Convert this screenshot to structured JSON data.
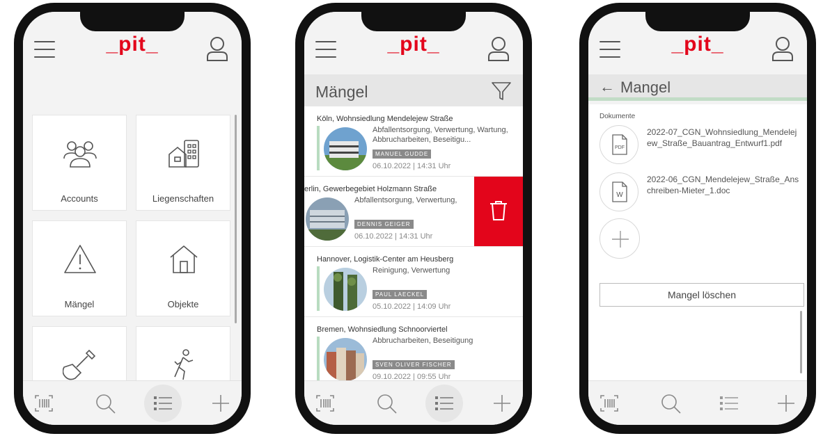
{
  "brand": {
    "logo": "_pit_",
    "accent_color": "#e3051b",
    "positive_color": "#b8dcc0"
  },
  "icons": {
    "menu": "hamburger-icon",
    "user": "user-icon",
    "barcode": "barcode-icon",
    "search": "search-icon",
    "list": "list-icon",
    "add": "plus-icon",
    "filter": "filter-icon",
    "delete": "trash-icon"
  },
  "phone1": {
    "tiles": [
      {
        "label": "Accounts",
        "icon": "users-icon"
      },
      {
        "label": "Liegenschaften",
        "icon": "buildings-icon"
      },
      {
        "label": "Mängel",
        "icon": "warning-icon"
      },
      {
        "label": "Objekte",
        "icon": "house-icon"
      },
      {
        "label": "",
        "icon": "shovel-icon"
      },
      {
        "label": "",
        "icon": "walking-person-icon"
      }
    ]
  },
  "phone2": {
    "title": "Mängel",
    "items": [
      {
        "address": "Köln, Wohnsiedlung Mendelejew Straße",
        "category": "Abfallentsorgung, Verwertung, Wartung, Abbrucharbeiten, Beseitigu...",
        "badge": "MANUEL GUDDE",
        "date": "06.10.2022 | 14:31 Uhr"
      },
      {
        "address": "erlin, Gewerbegebiet Holzmann Straße",
        "category": "Abfallentsorgung, Verwertung,",
        "badge": "DENNIS GEIGER",
        "date": "06.10.2022 | 14:31 Uhr"
      },
      {
        "address": "Hannover, Logistik-Center am Heusberg",
        "category": "Reinigung, Verwertung",
        "badge": "PAUL LAECKEL",
        "date": "05.10.2022 | 14:09 Uhr"
      },
      {
        "address": "Bremen, Wohnsiedlung Schnoorviertel",
        "category": "Abbrucharbeiten, Beseitigung",
        "badge": "SVEN OLIVER FISCHER",
        "date": "09.10.2022 | 09:55 Uhr"
      }
    ]
  },
  "phone3": {
    "back_title": "Mangel",
    "documents_label": "Dokumente",
    "documents": [
      {
        "name": "2022-07_CGN_Wohnsiedlung_Mendelejew_Straße_Bauantrag_Entwurf1.pdf",
        "type": "PDF"
      },
      {
        "name": "2022-06_CGN_Mendelejew_Straße_Anschreiben-Mieter_1.doc",
        "type": "W"
      }
    ],
    "delete_label": "Mangel löschen"
  }
}
